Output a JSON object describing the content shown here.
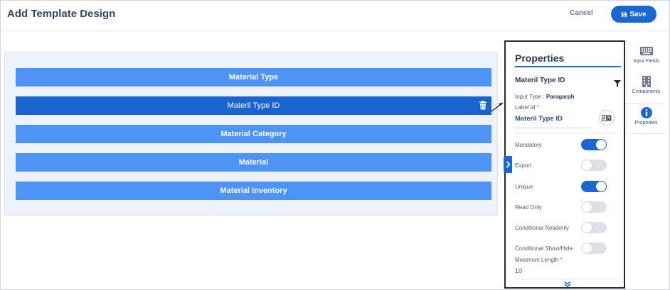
{
  "header": {
    "title": "Add Template Design",
    "cancel_label": "Cancel",
    "save_label": "Save"
  },
  "fields": [
    {
      "label": "Material Type",
      "selected": false
    },
    {
      "label": "Materil Type ID",
      "selected": true
    },
    {
      "label": "Material Category",
      "selected": false
    },
    {
      "label": "Material",
      "selected": false
    },
    {
      "label": "Material Inventory",
      "selected": false
    }
  ],
  "properties": {
    "title": "Properties",
    "field_name": "Materil Type ID",
    "input_type_caption": "Input Type :",
    "input_type_value": "Paragarph",
    "label_id_caption": "Label Id",
    "required_marker": "*",
    "label_id_value": "Materil Type ID",
    "translate_icon": "translate-icon",
    "toggles": [
      {
        "label": "Mandatory",
        "on": true
      },
      {
        "label": "Export",
        "on": false
      },
      {
        "label": "Unique",
        "on": true
      },
      {
        "label": "Read Only",
        "on": false
      },
      {
        "label": "Conditional Readonly",
        "on": false
      },
      {
        "label": "Conditional Show/Hide",
        "on": false
      }
    ],
    "max_length_caption": "Maximum Length",
    "max_length_value": "10"
  },
  "rail": {
    "items": [
      {
        "label": "Input Fields",
        "icon": "keyboard-icon"
      },
      {
        "label": "Components",
        "icon": "building-icon"
      },
      {
        "label": "Properties",
        "icon": "info-icon"
      }
    ]
  },
  "colors": {
    "primary": "#1a66d2",
    "field_bar": "#4d93f6",
    "field_bar_selected": "#1764cf",
    "toggle_off": "#dde1e7"
  }
}
